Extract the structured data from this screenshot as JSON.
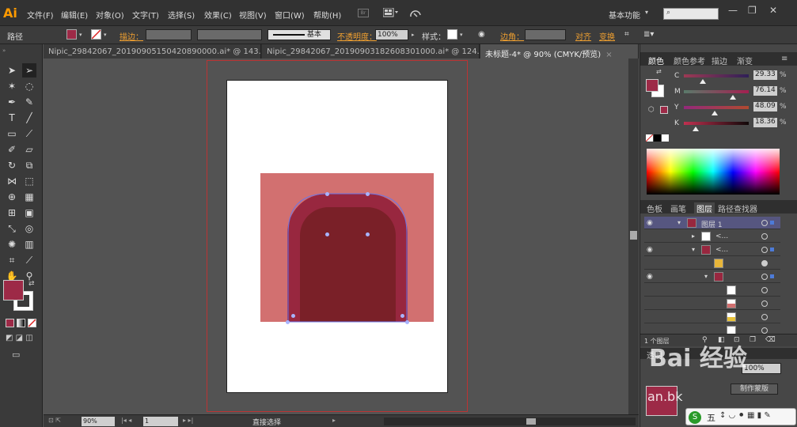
{
  "app": {
    "logo": "Ai"
  },
  "menu": [
    "文件(F)",
    "编辑(E)",
    "对象(O)",
    "文字(T)",
    "选择(S)",
    "效果(C)",
    "视图(V)",
    "窗口(W)",
    "帮助(H)"
  ],
  "toolbar_icons": {
    "bridge": "Br"
  },
  "workspace": {
    "label": "基本功能",
    "search_placeholder": ""
  },
  "window_controls": [
    "—",
    "❐",
    "✕"
  ],
  "control_bar": {
    "selection_type": "路径",
    "stroke_label": "描边：",
    "stroke_style": "基本",
    "opacity_label": "不透明度：",
    "opacity_value": "100%",
    "style_label": "样式：",
    "corner_label": "边角：",
    "align_label": "对齐",
    "transform_label": "变换",
    "fill_color": "#9d2a47"
  },
  "tabs": [
    {
      "label": "Nipic_29842067_20190905150420890000.ai* @ 143.4...",
      "active": false
    },
    {
      "label": "Nipic_29842067_20190903182608301000.ai* @ 124.2...",
      "active": false
    },
    {
      "label": "未标题-4* @ 90% (CMYK/预览)",
      "active": true
    }
  ],
  "artwork": {
    "background_color": "#d27070",
    "arch_outer_color": "#98273f",
    "arch_inner_color": "#7a2028"
  },
  "status": {
    "zoom": "90%",
    "page": "1",
    "tool": "直接选择"
  },
  "color_panel": {
    "tabs": [
      "颜色",
      "颜色参考",
      "描边",
      "渐变"
    ],
    "channels": [
      {
        "label": "C",
        "value": "29.33",
        "level": 0.293
      },
      {
        "label": "M",
        "value": "76.14",
        "level": 0.761
      },
      {
        "label": "Y",
        "value": "48.09",
        "level": 0.481
      },
      {
        "label": "K",
        "value": "18.36",
        "level": 0.184
      }
    ],
    "percent": "%"
  },
  "layers_panel": {
    "tabs": [
      "色板",
      "画笔",
      "图层",
      "路径查找器"
    ],
    "rows": [
      {
        "label": "图层 1",
        "thumb": "#98273f"
      },
      {
        "label": "<...",
        "thumb": "#ffffff"
      },
      {
        "label": "<...",
        "thumb": "#98273f"
      },
      {
        "label": "",
        "thumb": "#e8b63a"
      },
      {
        "label": "",
        "thumb": "#98273f"
      },
      {
        "label": "",
        "thumb": "#ffffff"
      },
      {
        "label": "",
        "thumb": "#d27070"
      },
      {
        "label": "",
        "thumb": "#e8c23a"
      },
      {
        "label": "",
        "thumb": "#ffffff"
      }
    ],
    "footer_count": "1 个图层"
  },
  "transparency_panel": {
    "tab_label": "透明",
    "opacity": "100%",
    "button_label": "制作蒙版"
  },
  "watermark": {
    "text": "Bai 经验",
    "sub": "an.bk"
  },
  "ime": {
    "label": "五"
  }
}
